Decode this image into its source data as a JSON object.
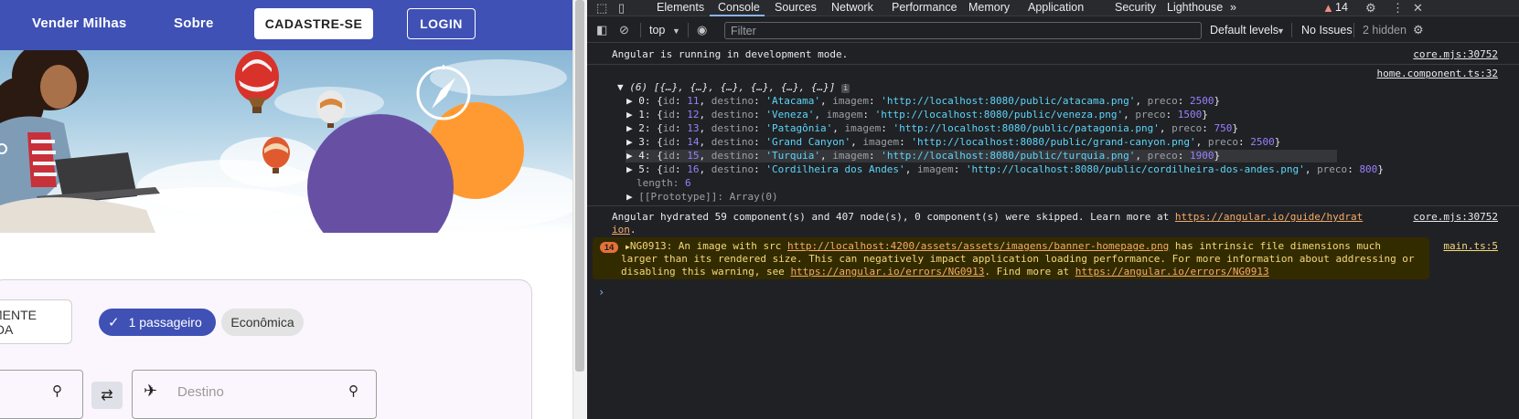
{
  "site": {
    "nav": {
      "sell_miles": "Vender Milhas",
      "about": "Sobre",
      "signup": "CADASTRE-SE",
      "login": "LOGIN"
    },
    "search": {
      "trip_type": "MENTE IDA",
      "passengers": "1 passageiro",
      "cabin": "Econômica",
      "destination_placeholder": "Destino"
    },
    "colors": {
      "primary": "#3f51b5",
      "circle_purple": "#6750a4",
      "circle_orange": "#ff9a33"
    }
  },
  "devtools": {
    "tabs": [
      "Elements",
      "Console",
      "Sources",
      "Network",
      "Performance",
      "Memory",
      "Application",
      "Security",
      "Lighthouse"
    ],
    "active_tab": "Console",
    "more_tabs": "»",
    "issue_count": "14",
    "toolbar": {
      "context": "top",
      "filter_placeholder": "Filter",
      "levels": "Default levels",
      "issues": "No Issues",
      "hidden": "2 hidden"
    },
    "console": {
      "msg1": "Angular is running in development mode.",
      "msg1_src": "core.mjs:30752",
      "msg2_src": "home.component.ts:32",
      "array_header": "(6) [{…}, {…}, {…}, {…}, {…}, {…}]",
      "items": [
        {
          "idx": "0",
          "id": "11",
          "destino": "'Atacama'",
          "imagem": "'http://localhost:8080/public/atacama.png'",
          "preco": "2500"
        },
        {
          "idx": "1",
          "id": "12",
          "destino": "'Veneza'",
          "imagem": "'http://localhost:8080/public/veneza.png'",
          "preco": "1500"
        },
        {
          "idx": "2",
          "id": "13",
          "destino": "'Patagônia'",
          "imagem": "'http://localhost:8080/public/patagonia.png'",
          "preco": "750"
        },
        {
          "idx": "3",
          "id": "14",
          "destino": "'Grand Canyon'",
          "imagem": "'http://localhost:8080/public/grand-canyon.png'",
          "preco": "2500"
        },
        {
          "idx": "4",
          "id": "15",
          "destino": "'Turquia'",
          "imagem": "'http://localhost:8080/public/turquia.png'",
          "preco": "1900"
        },
        {
          "idx": "5",
          "id": "16",
          "destino": "'Cordilheira dos Andes'",
          "imagem": "'http://localhost:8080/public/cordilheira-dos-andes.png'",
          "preco": "800"
        }
      ],
      "length_label": "length",
      "length_value": "6",
      "prototype": "[[Prototype]]: Array(0)",
      "hydrated_text": "Angular hydrated 59 component(s) and 407 node(s), 0 component(s) were skipped. Learn more at ",
      "hydrated_link_1": "https://angular.io/guide/hydrat",
      "hydrated_link_2": "ion",
      "hydrated_end": ".",
      "hydrated_src": "core.mjs:30752",
      "warn_count": "14",
      "warn_line1_a": "NG0913: An image with src ",
      "warn_line1_link": "http://localhost:4200/assets/assets/imagens/banner-homepage.png",
      "warn_line1_b": " has intrinsic file dimensions much",
      "warn_line2": "larger than its rendered size. This can negatively impact application loading performance. For more information about addressing or",
      "warn_line3_a": "disabling this warning, see ",
      "warn_line3_link1": "https://angular.io/errors/NG0913",
      "warn_line3_b": ". Find more at ",
      "warn_line3_link2": "https://angular.io/errors/NG0913",
      "warn_src": "main.ts:5",
      "prompt": "›"
    }
  }
}
